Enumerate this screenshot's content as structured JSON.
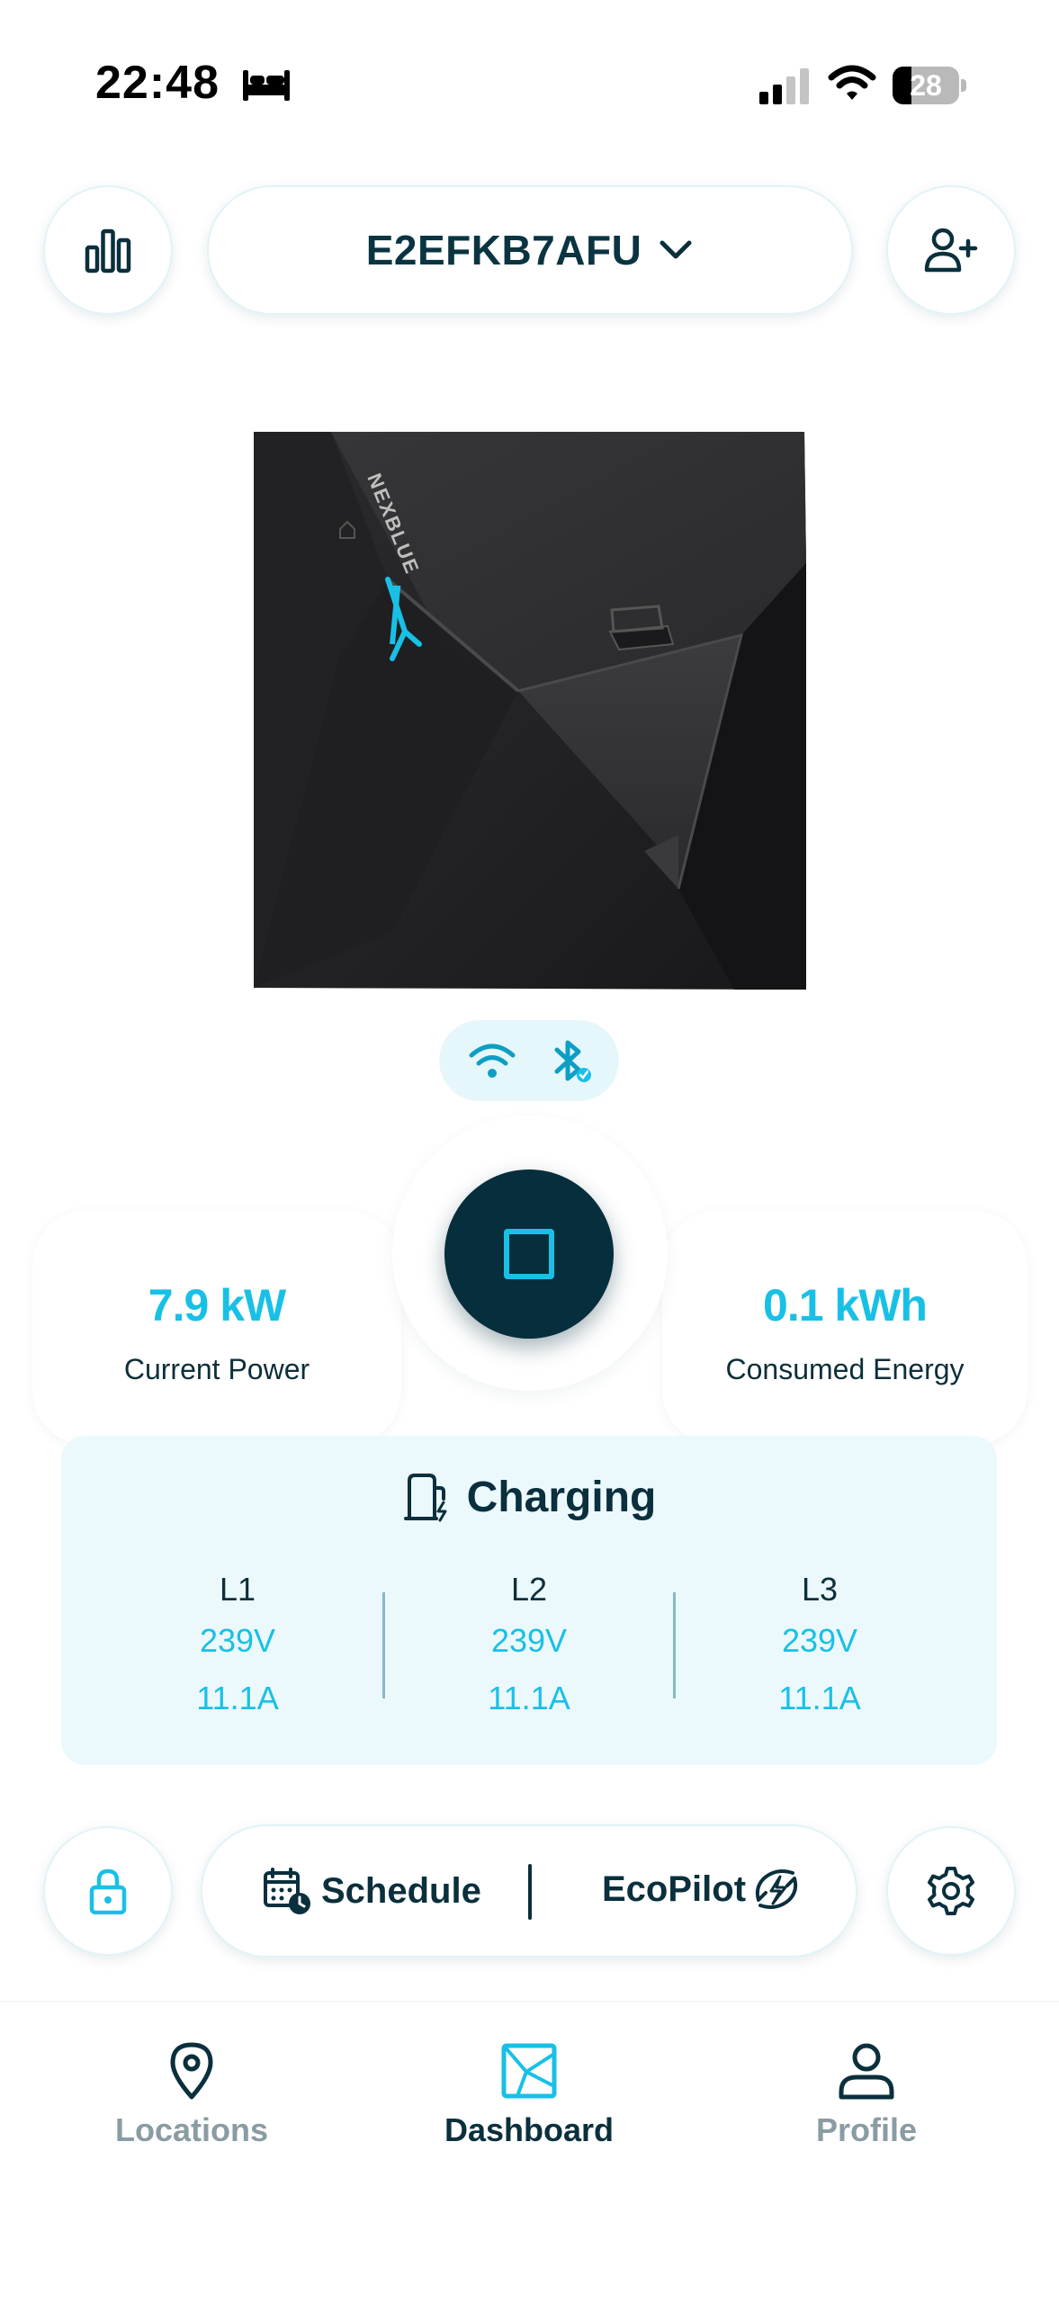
{
  "status_bar": {
    "time": "22:48",
    "battery": "28",
    "battery_level_percent": 28
  },
  "header": {
    "device_id": "E2EFKB7AFU",
    "stats_icon": "bar-chart-icon",
    "add_user_icon": "user-plus-icon",
    "dropdown_icon": "chevron-down-icon"
  },
  "charger": {
    "brand_mark": "NEXBLUE"
  },
  "connectivity": {
    "wifi_icon": "wifi-icon",
    "bluetooth_icon": "bluetooth-connected-icon"
  },
  "metrics": {
    "current_power_value": "7.9 kW",
    "current_power_label": "Current Power",
    "consumed_energy_value": "0.1 kWh",
    "consumed_energy_label": "Consumed Energy"
  },
  "charging": {
    "status": "Charging",
    "phases": [
      {
        "name": "L1",
        "voltage": "239V",
        "current": "11.1A"
      },
      {
        "name": "L2",
        "voltage": "239V",
        "current": "11.1A"
      },
      {
        "name": "L3",
        "voltage": "239V",
        "current": "11.1A"
      }
    ]
  },
  "actions": {
    "schedule_label": "Schedule",
    "ecopilot_label": "EcoPilot",
    "lock_icon": "lock-icon",
    "settings_icon": "gear-icon"
  },
  "tabs": [
    {
      "label": "Locations",
      "icon": "map-pin-icon",
      "active": false
    },
    {
      "label": "Dashboard",
      "icon": "dashboard-icon",
      "active": true
    },
    {
      "label": "Profile",
      "icon": "person-icon",
      "active": false
    }
  ],
  "colors": {
    "accent": "#19c0e6",
    "dark": "#0a2f3d",
    "panel": "#ecf9fc",
    "inactive_tab": "#8a9ca3"
  }
}
